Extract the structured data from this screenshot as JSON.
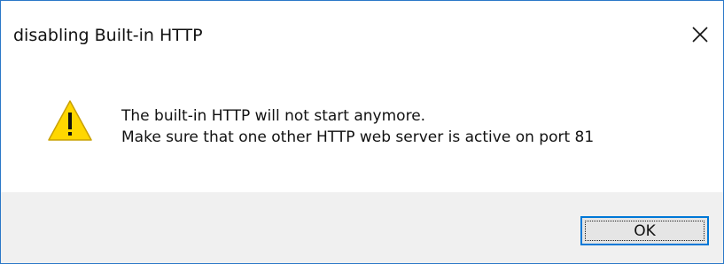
{
  "window": {
    "title": "disabling Built-in HTTP"
  },
  "icons": {
    "close": "close-icon",
    "warning": "warning-icon"
  },
  "message": {
    "line1": "The built-in HTTP will not start anymore.",
    "line2": "Make sure that one other HTTP web server is active on port 81"
  },
  "buttons": {
    "ok_label": "OK"
  },
  "colors": {
    "border": "#2b78c8",
    "footer_bg": "#f0f0f0",
    "warning_fill": "#ffd700",
    "button_focus_border": "#0078d7"
  }
}
